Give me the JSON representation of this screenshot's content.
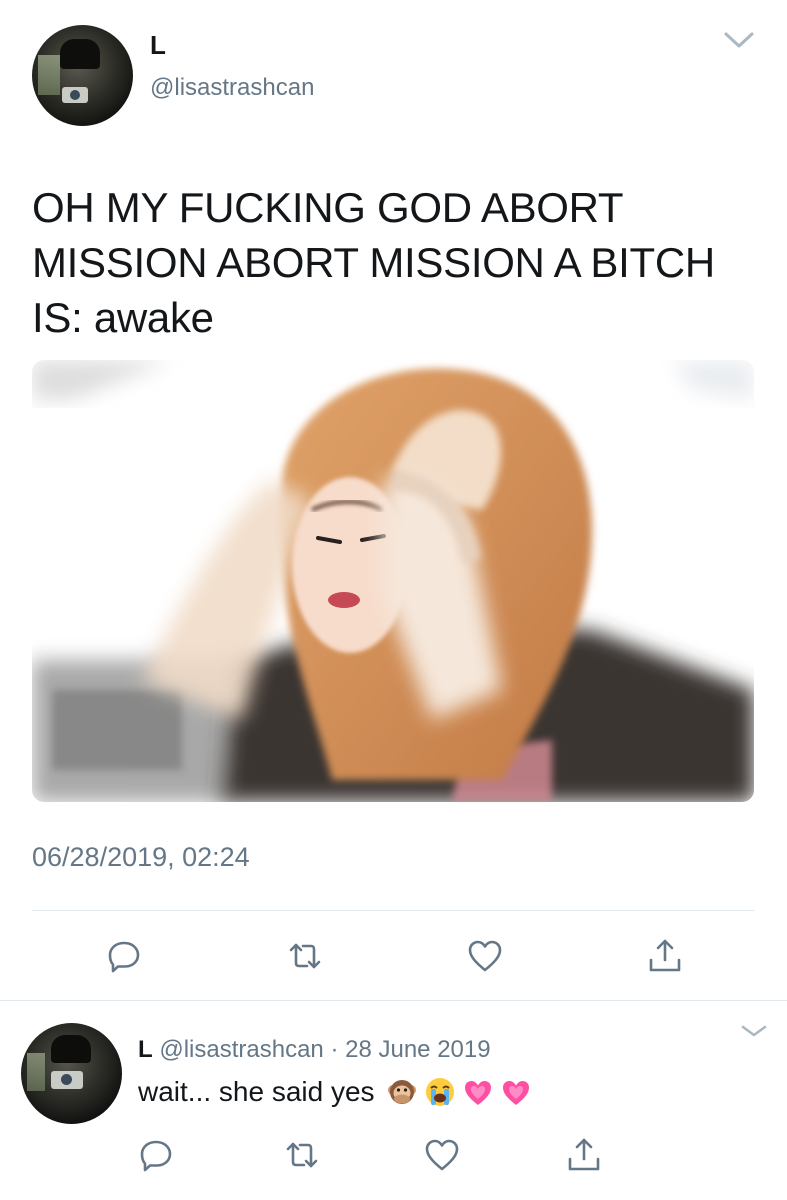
{
  "tweet": {
    "display_name": "L",
    "handle": "@lisastrashcan",
    "text": "OH MY FUCKING GOD ABORT MISSION ABORT MISSION A BITCH IS: awake",
    "timestamp": "06/28/2019, 02:24",
    "media_icon": "photo-of-person-holding-head"
  },
  "actions": {
    "reply_icon": "reply-icon",
    "retweet_icon": "retweet-icon",
    "like_icon": "heart-icon",
    "share_icon": "share-icon"
  },
  "reply": {
    "display_name": "L",
    "handle": "@lisastrashcan",
    "separator": "·",
    "date": "28 June 2019",
    "text": "wait... she said yes",
    "emojis": [
      "speak-no-evil-monkey",
      "loudly-crying-face",
      "growing-heart",
      "growing-heart"
    ]
  },
  "colors": {
    "text": "#14171a",
    "secondary": "#657786",
    "divider": "#e1e8ed"
  }
}
